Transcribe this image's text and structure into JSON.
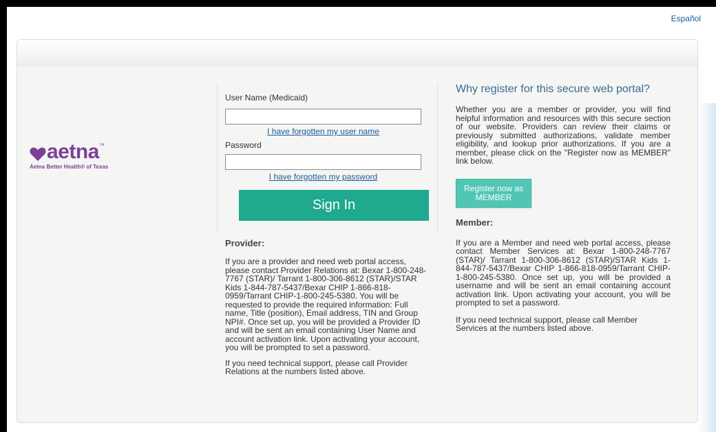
{
  "header": {
    "language_link": "Español"
  },
  "logo": {
    "wordmark": "aetna",
    "trademark": "™",
    "subtitle": "Aetna Better Health® of Texas"
  },
  "login": {
    "username_label": "User Name (Medicaid)",
    "username_value": "",
    "forgot_username": "I have forgotten my user name",
    "password_label": "Password",
    "password_value": "",
    "forgot_password": "I have forgotten my password",
    "signin_label": "Sign In"
  },
  "provider": {
    "title": "Provider:",
    "text1": "If you are a provider and need web portal access, please contact Provider Relations at: Bexar 1-800-248-7767 (STAR)/ Tarrant 1-800-306-8612 (STAR)/STAR Kids 1-844-787-5437/Bexar CHIP 1-866-818-0959/Tarrant CHIP-1-800-245-5380. You will be requested to provide the required information: Full name, Title (position), Email address, TIN and Group NPI#. Once set up, you will be provided a Provider ID and will be sent an email containing User Name and account activation link. Upon activating your account, you will be prompted to set a password.",
    "text2": "If you need technical support, please call Provider Relations at the numbers listed above."
  },
  "why": {
    "title": "Why register for this secure web portal?",
    "text": "Whether you are a member or provider, you will find helpful information and resources with this secure section of our website. Providers can review their claims or previously submitted authorizations, validate member eligibility, and lookup prior authorizations. If you are a member, please click on the \"Register now as MEMBER\" link below.",
    "register_label": "Register now as MEMBER"
  },
  "member": {
    "title": "Member:",
    "text1": "If you are a Member and need web portal access, please contact Member Services at: Bexar 1-800-248-7767 (STAR)/ Tarrant 1-800-306-8612 (STAR)/STAR Kids 1-844-787-5437/Bexar CHIP 1-866-818-0959/Tarrant CHIP-1-800-245-5380. Once set up, you will be provided a username and will be sent an email containing account activation link. Upon activating your account, you will be prompted to set a password.",
    "text2": "If you need technical support, please call Member Services at the numbers listed above."
  },
  "colors": {
    "brand_purple": "#7d3f98",
    "signin_green": "#1fa98e",
    "register_teal": "#52c6b4",
    "link_blue": "#1a5a96",
    "heading_blue": "#3a6c94"
  }
}
